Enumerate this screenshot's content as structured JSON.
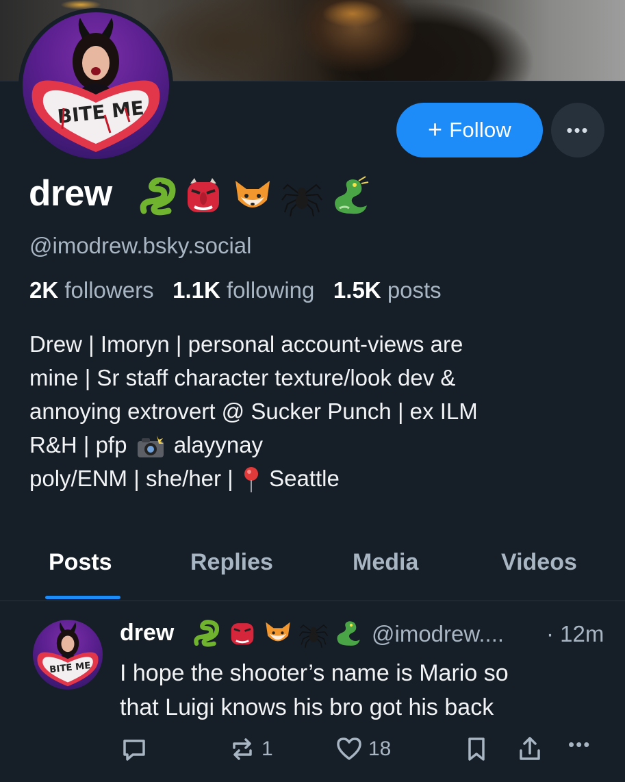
{
  "profile": {
    "display_name": "drew",
    "name_emojis": [
      "snake-emoji",
      "goblin-mask-emoji",
      "fox-emoji",
      "spider-emoji",
      "dragon-emoji"
    ],
    "handle": "@imodrew.bsky.social",
    "avatar_text": "BITE ME",
    "stats": {
      "followers_count": "2K",
      "followers_label": "followers",
      "following_count": "1.1K",
      "following_label": "following",
      "posts_count": "1.5K",
      "posts_label": "posts"
    },
    "bio": {
      "line1": "Drew | Imoryn | personal account-views are",
      "line2": "mine | Sr staff character texture/look dev &",
      "line3": "annoying extrovert @ Sucker Punch | ex ILM",
      "line4a": "R&H | pfp",
      "line4b": "alayynay",
      "line5a": "poly/ENM | she/her |",
      "line5b": "Seattle"
    }
  },
  "actions": {
    "follow_label": "Follow",
    "more_label": "•••"
  },
  "tabs": [
    {
      "label": "Posts",
      "active": true
    },
    {
      "label": "Replies",
      "active": false
    },
    {
      "label": "Media",
      "active": false
    },
    {
      "label": "Videos",
      "active": false
    }
  ],
  "post": {
    "author_name": "drew",
    "author_handle": "@imodrew....",
    "time": "· 12m",
    "text_line1": "I hope the shooter’s name is Mario so",
    "text_line2": "that Luigi knows his bro got his back",
    "reply_count": "",
    "repost_count": "1",
    "like_count": "18",
    "more_label": "•••"
  },
  "colors": {
    "background": "#161e27",
    "accent": "#1d8cf8",
    "muted_text": "#a8b6c4"
  }
}
